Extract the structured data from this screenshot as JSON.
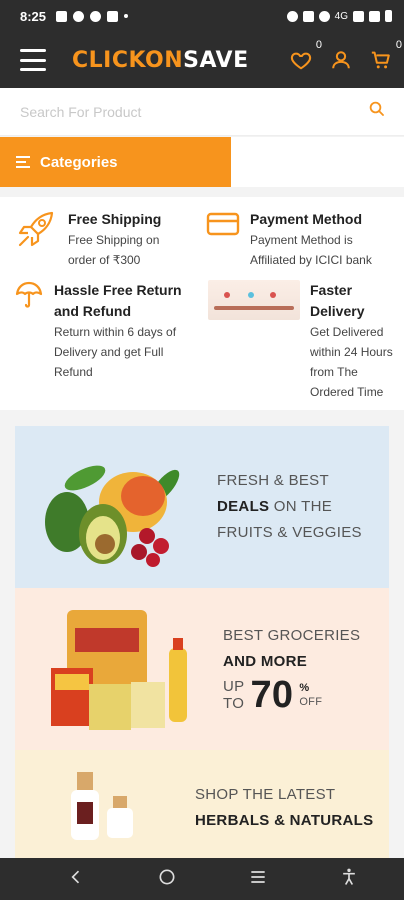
{
  "status_bar": {
    "time": "8:25",
    "network": "4G"
  },
  "header": {
    "logo_part1": "CLICKON",
    "logo_part2": "SAVE",
    "wishlist_count": "0",
    "cart_count": "0"
  },
  "search": {
    "placeholder": "Search For Product"
  },
  "categories": {
    "label": "Categories"
  },
  "features": [
    {
      "title": "Free Shipping",
      "desc": "Free Shipping on order of ₹300"
    },
    {
      "title": "Payment Method",
      "desc": "Payment Method is Affiliated by ICICI bank"
    },
    {
      "title": "Hassle Free Return and Refund",
      "desc": "Return within 6 days of Delivery and get Full Refund"
    },
    {
      "title": "Faster Delivery",
      "desc": "Get Delivered within 24 Hours from The Ordered Time"
    }
  ],
  "banners": {
    "fruits": {
      "line1": "FRESH & BEST",
      "line2_bold": "DEALS",
      "line2_rest": " ON THE",
      "line3": "FRUITS & VEGGIES"
    },
    "grocery": {
      "line1": "BEST GROCERIES",
      "line2_bold": "AND MORE",
      "up": "UP",
      "to": "TO",
      "percent": "70",
      "percent_sign": "%",
      "off": "OFF"
    },
    "herbals": {
      "line1": "SHOP THE LATEST",
      "line2_bold": "HERBALS & NATURALS"
    }
  },
  "colors": {
    "accent": "#f7941d",
    "dark": "#2d2d2d"
  },
  "icons": {
    "menu": "hamburger-icon",
    "wishlist": "heart-icon",
    "account": "user-icon",
    "cart": "cart-icon",
    "search": "search-icon",
    "categories": "list-icon",
    "free_shipping": "rocket-icon",
    "payment": "card-icon",
    "return": "umbrella-icon"
  }
}
